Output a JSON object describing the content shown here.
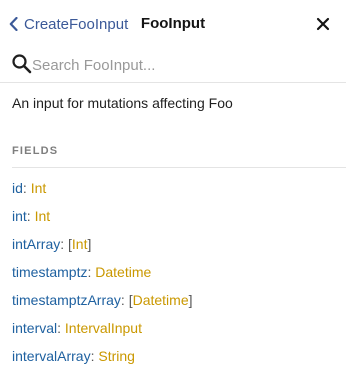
{
  "header": {
    "back_label": "CreateFooInput",
    "title": "FooInput"
  },
  "search": {
    "placeholder": "Search FooInput..."
  },
  "description": "An input for mutations affecting Foo",
  "fields_section": {
    "title": "FIELDS",
    "items": [
      {
        "name": "id",
        "type": "Int",
        "list": false
      },
      {
        "name": "int",
        "type": "Int",
        "list": false
      },
      {
        "name": "intArray",
        "type": "Int",
        "list": true
      },
      {
        "name": "timestamptz",
        "type": "Datetime",
        "list": false
      },
      {
        "name": "timestamptzArray",
        "type": "Datetime",
        "list": true
      },
      {
        "name": "interval",
        "type": "IntervalInput",
        "list": false
      },
      {
        "name": "intervalArray",
        "type": "String",
        "list": false
      }
    ]
  },
  "colors": {
    "link": "#3b5998",
    "field_name": "#1f61a0",
    "type_name": "#ca9800",
    "section_title": "#7e7e7e"
  },
  "icons": {
    "back": "chevron-left-icon",
    "close": "close-icon",
    "search": "search-icon"
  }
}
